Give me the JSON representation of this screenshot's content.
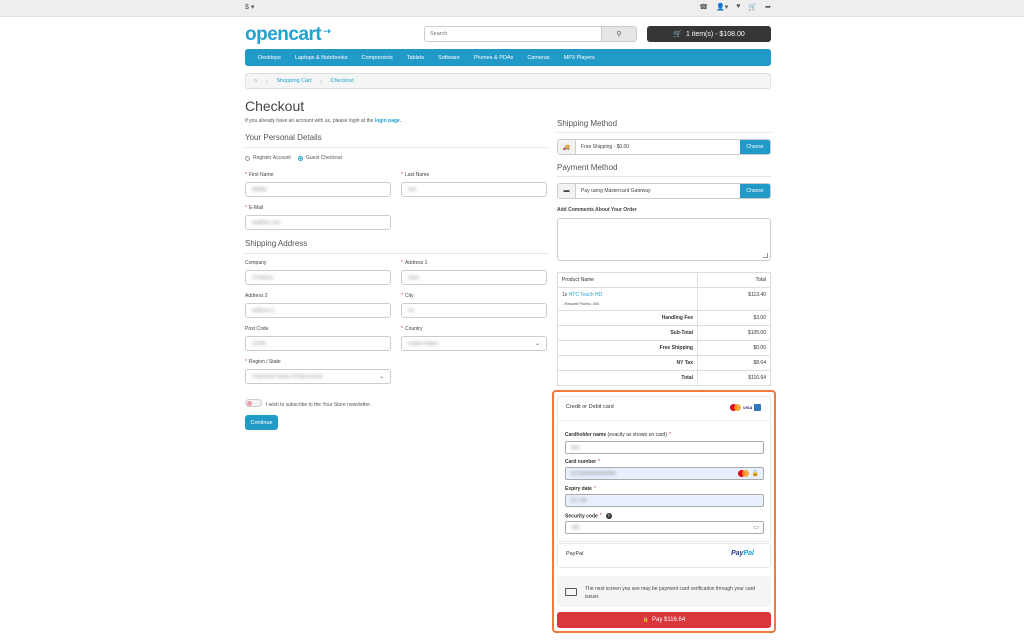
{
  "topbar": {
    "currency": "$ ▾"
  },
  "header": {
    "logo": "opencart",
    "search_placeholder": "Search",
    "cart_label": "1 item(s) - $108.00"
  },
  "menu": [
    "Desktops",
    "Laptops & Notebooks",
    "Components",
    "Tablets",
    "Software",
    "Phones & PDAs",
    "Cameras",
    "MP3 Players"
  ],
  "breadcrumb": [
    "Shopping Cart",
    "Checkout"
  ],
  "page": {
    "title": "Checkout",
    "login_prefix": "If you already have an account with us, please login at the",
    "login_link": "login page."
  },
  "personal": {
    "heading": "Your Personal Details",
    "register_label": "Register Account",
    "guest_label": "Guest Checkout",
    "first_name_label": "First Name",
    "first_name_value": "Bbbbb",
    "last_name_label": "Last Name",
    "last_name_value": "test",
    "email_label": "E-Mail",
    "email_value": "aa@hte.com"
  },
  "shipping_address": {
    "heading": "Shipping Address",
    "company_label": "Company",
    "company_value": "Company",
    "address1_label": "Address 1",
    "address1_value": "aaaa",
    "address2_label": "Address 2",
    "address2_value": "Address 2",
    "city_label": "City",
    "city_value": "ha",
    "postcode_label": "Post Code",
    "postcode_value": "12345",
    "country_label": "Country",
    "country_value": "United States",
    "region_label": "Region / State",
    "region_value": "Federated States Of Micronesia",
    "newsletter_label": "I wish to subscribe to the Your Store newsletter.",
    "continue_label": "Continue"
  },
  "shipping_method": {
    "heading": "Shipping Method",
    "value": "Free Shipping - $0.00",
    "button": "Choose"
  },
  "payment_method": {
    "heading": "Payment Method",
    "value": "Pay using Mastercard Gateway",
    "button": "Choose"
  },
  "comments": {
    "label": "Add Comments About Your Order"
  },
  "order": {
    "col_product": "Product Name",
    "col_total": "Total",
    "product_qty": "1x",
    "product_name": "HTC Touch HD",
    "product_points": "- Reward Points: 400",
    "product_total": "$113.40",
    "rows": [
      {
        "label": "Handling Fee",
        "value": "$3.00"
      },
      {
        "label": "Sub-Total",
        "value": "$105.00"
      },
      {
        "label": "Free Shipping",
        "value": "$0.00"
      },
      {
        "label": "NY Tax",
        "value": "$8.64"
      },
      {
        "label": "Total",
        "value": "$116.64"
      }
    ]
  },
  "payment_form": {
    "card_heading": "Credit or Debit card",
    "holder_label": "Cardholder name",
    "holder_note": "(exactly as shown on card)",
    "holder_value": "test",
    "number_label": "Card number",
    "number_value": "5123450000000008",
    "expiry_label": "Expiry date",
    "expiry_value": "01 / 39",
    "cvc_label": "Security code",
    "cvc_value": "100",
    "paypal_label": "PayPal",
    "paypal_logo_a": "Pay",
    "paypal_logo_b": "Pal",
    "notice": "The next screen you see may be payment card verification through your card issuer.",
    "pay_label": "Pay $116.64"
  },
  "colors": {
    "accent": "#229ac8",
    "highlight_border": "#f07b3f",
    "pay_button": "#d9373b"
  }
}
